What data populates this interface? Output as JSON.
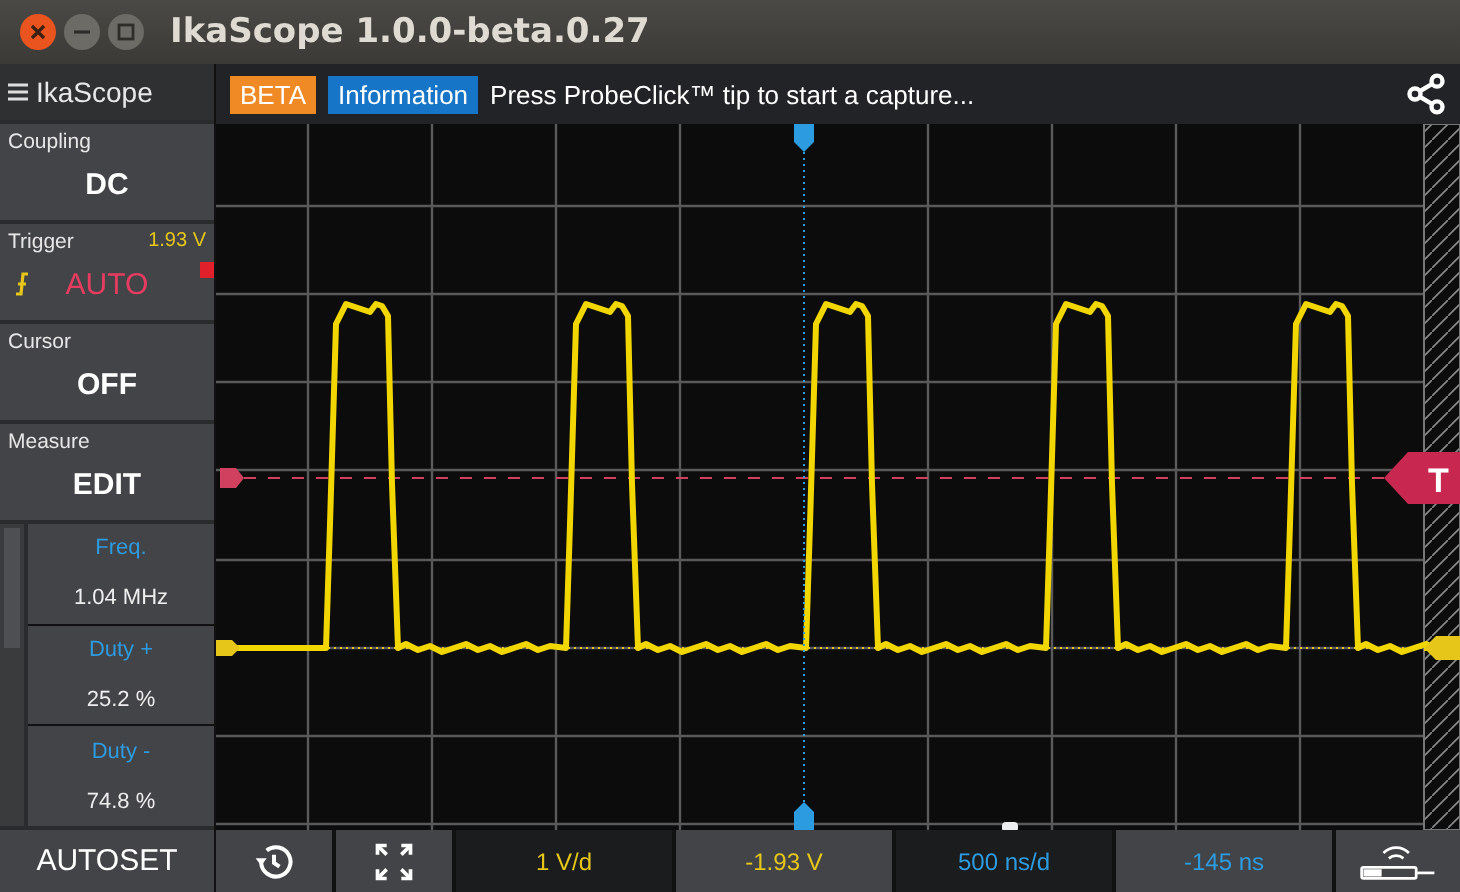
{
  "window": {
    "title": "IkaScope 1.0.0-beta.0.27"
  },
  "toolbar": {
    "app_name": "IkaScope",
    "badges": [
      {
        "label": "BETA",
        "kind": "beta"
      },
      {
        "label": "Information",
        "kind": "info"
      }
    ],
    "message": "Press ProbeClick™ tip to start a capture..."
  },
  "sidebar": [
    {
      "kind": "plain",
      "label": "Coupling",
      "value": "DC"
    },
    {
      "kind": "trigger",
      "label": "Trigger",
      "level_text": "1.93 V",
      "value": "AUTO"
    },
    {
      "kind": "plain",
      "label": "Cursor",
      "value": "OFF"
    },
    {
      "kind": "plain",
      "label": "Measure",
      "value": "EDIT"
    }
  ],
  "measurements": [
    {
      "name": "Freq.",
      "value": "1.04 MHz"
    },
    {
      "name": "Duty +",
      "value": "25.2 %"
    },
    {
      "name": "Duty -",
      "value": "74.8 %"
    }
  ],
  "autoset": "AUTOSET",
  "trigger_handle": "T",
  "bottom_bar": [
    {
      "text": "1 V/d",
      "kind": "vscale"
    },
    {
      "text": "-1.93 V",
      "kind": "voffset"
    },
    {
      "text": "500 ns/d",
      "kind": "tscale"
    },
    {
      "text": "-145 ns",
      "kind": "toffset"
    }
  ]
}
